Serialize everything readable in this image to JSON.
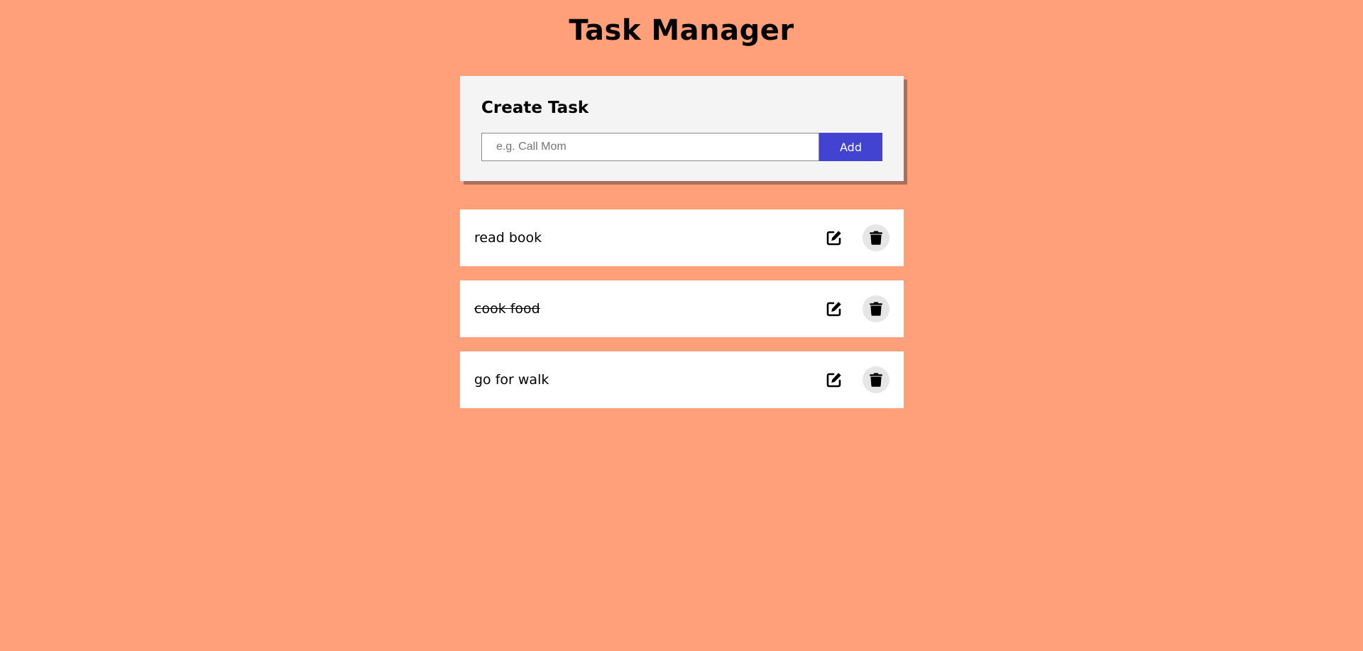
{
  "header": {
    "title": "Task Manager"
  },
  "create": {
    "title": "Create Task",
    "placeholder": "e.g. Call Mom",
    "value": "",
    "add_label": "Add"
  },
  "tasks": [
    {
      "text": "read book",
      "completed": false
    },
    {
      "text": "cook food",
      "completed": true
    },
    {
      "text": "go for walk",
      "completed": false
    }
  ],
  "icons": {
    "edit": "edit-icon",
    "delete": "trash-icon"
  },
  "colors": {
    "background": "#ffa07a",
    "accent": "#4343d1",
    "card": "#f4f4f4"
  }
}
